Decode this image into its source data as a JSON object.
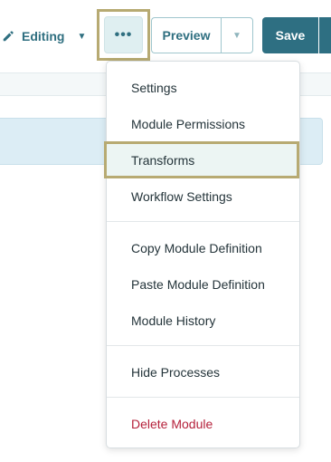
{
  "toolbar": {
    "editing_label": "Editing",
    "more_label": "•••",
    "preview_label": "Preview",
    "save_label": "Save"
  },
  "menu": {
    "items": [
      {
        "label": "Settings"
      },
      {
        "label": "Module Permissions"
      },
      {
        "label": "Transforms"
      },
      {
        "label": "Workflow Settings"
      },
      {
        "label": "Copy Module Definition"
      },
      {
        "label": "Paste Module Definition"
      },
      {
        "label": "Module History"
      },
      {
        "label": "Hide Processes"
      },
      {
        "label": "Delete Module"
      }
    ]
  },
  "colors": {
    "accent": "#2e6f82",
    "highlight_border": "#b7aa72",
    "danger": "#b5213b"
  }
}
